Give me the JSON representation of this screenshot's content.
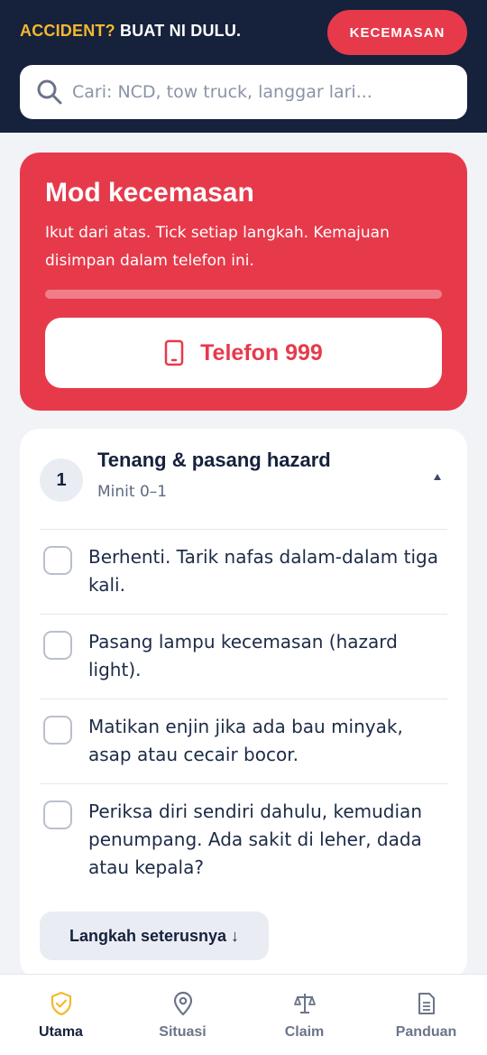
{
  "header": {
    "tagline_accent": "ACCIDENT?",
    "tagline_rest": " BUAT NI DULU.",
    "panic_button_label": "KECEMASAN",
    "search_placeholder": "Cari: NCD, tow truck, langgar lari...",
    "search_value": ""
  },
  "emergency": {
    "title": "Mod kecemasan",
    "description": "Ikut dari atas. Tick setiap langkah. Kemajuan disimpan dalam telefon ini.",
    "progress_fraction": 0.0,
    "call_button_label": "Telefon 999"
  },
  "step": {
    "number": "1",
    "title": "Tenang & pasang hazard",
    "subtitle": "Minit 0–1",
    "items": [
      {
        "text": "Berhenti. Tarik nafas dalam-dalam tiga kali.",
        "checked": false
      },
      {
        "text": "Pasang lampu kecemasan (hazard light).",
        "checked": false
      },
      {
        "text": "Matikan enjin jika ada bau minyak, asap atau cecair bocor.",
        "checked": false
      },
      {
        "text": "Periksa diri sendiri dahulu, kemudian penumpang. Ada sakit di leher, dada atau kepala?",
        "checked": false
      }
    ],
    "next_button_label": "Langkah seterusnya ↓"
  },
  "tabs": [
    {
      "label": "Utama",
      "icon": "shield-check-icon",
      "active": true
    },
    {
      "label": "Situasi",
      "icon": "map-pin-icon",
      "active": false
    },
    {
      "label": "Claim",
      "icon": "scale-icon",
      "active": false
    },
    {
      "label": "Panduan",
      "icon": "document-icon",
      "active": false
    }
  ],
  "colors": {
    "header_bg": "#16213c",
    "accent_yellow": "#f5b82e",
    "emergency_red": "#e63a4b",
    "active_tab_icon": "#f5b82e"
  }
}
